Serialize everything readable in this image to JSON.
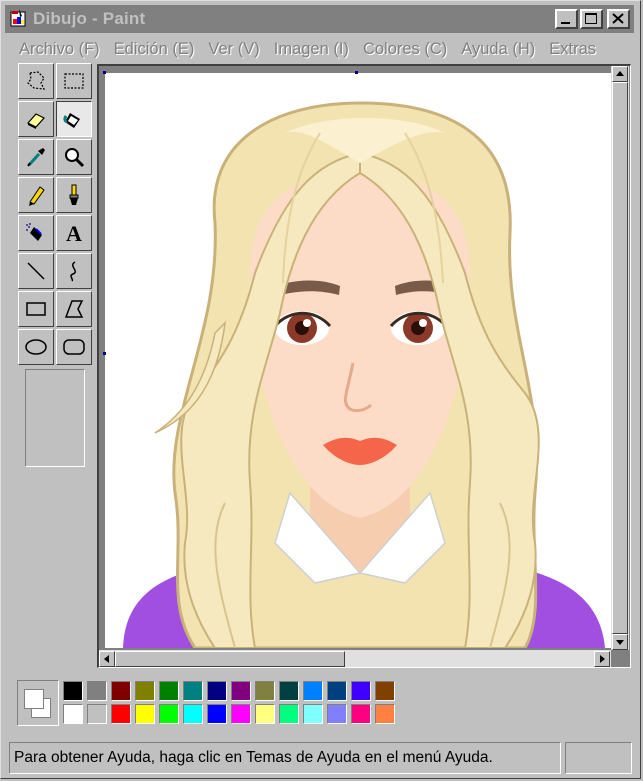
{
  "window": {
    "title": "Dibujo - Paint"
  },
  "menu": [
    {
      "label": "Archivo (F)"
    },
    {
      "label": "Edición (E)"
    },
    {
      "label": "Ver (V)"
    },
    {
      "label": "Imagen (I)"
    },
    {
      "label": "Colores (C)"
    },
    {
      "label": "Ayuda (H)"
    },
    {
      "label": "Extras"
    }
  ],
  "tools": [
    {
      "name": "free-select-icon"
    },
    {
      "name": "rect-select-icon"
    },
    {
      "name": "eraser-icon"
    },
    {
      "name": "fill-bucket-icon",
      "active": true
    },
    {
      "name": "eyedropper-icon"
    },
    {
      "name": "magnifier-icon"
    },
    {
      "name": "pencil-icon"
    },
    {
      "name": "brush-icon"
    },
    {
      "name": "airbrush-icon"
    },
    {
      "name": "text-icon",
      "glyph": "A"
    },
    {
      "name": "line-icon"
    },
    {
      "name": "curve-icon"
    },
    {
      "name": "rectangle-icon"
    },
    {
      "name": "polygon-icon"
    },
    {
      "name": "ellipse-icon"
    },
    {
      "name": "rounded-rect-icon"
    }
  ],
  "palette": {
    "foreground": "#000000",
    "background": "#ffffff",
    "row1": [
      "#000000",
      "#808080",
      "#800000",
      "#808000",
      "#008000",
      "#008080",
      "#000080",
      "#800080",
      "#808040",
      "#004040",
      "#0080ff",
      "#004080",
      "#4000ff",
      "#804000"
    ],
    "row2": [
      "#ffffff",
      "#c0c0c0",
      "#ff0000",
      "#ffff00",
      "#00ff00",
      "#00ffff",
      "#0000ff",
      "#ff00ff",
      "#ffff80",
      "#00ff80",
      "#80ffff",
      "#8080ff",
      "#ff0080",
      "#ff8040"
    ]
  },
  "status": {
    "text": "Para obtener Ayuda, haga clic en Temas de Ayuda en el menú Ayuda."
  }
}
